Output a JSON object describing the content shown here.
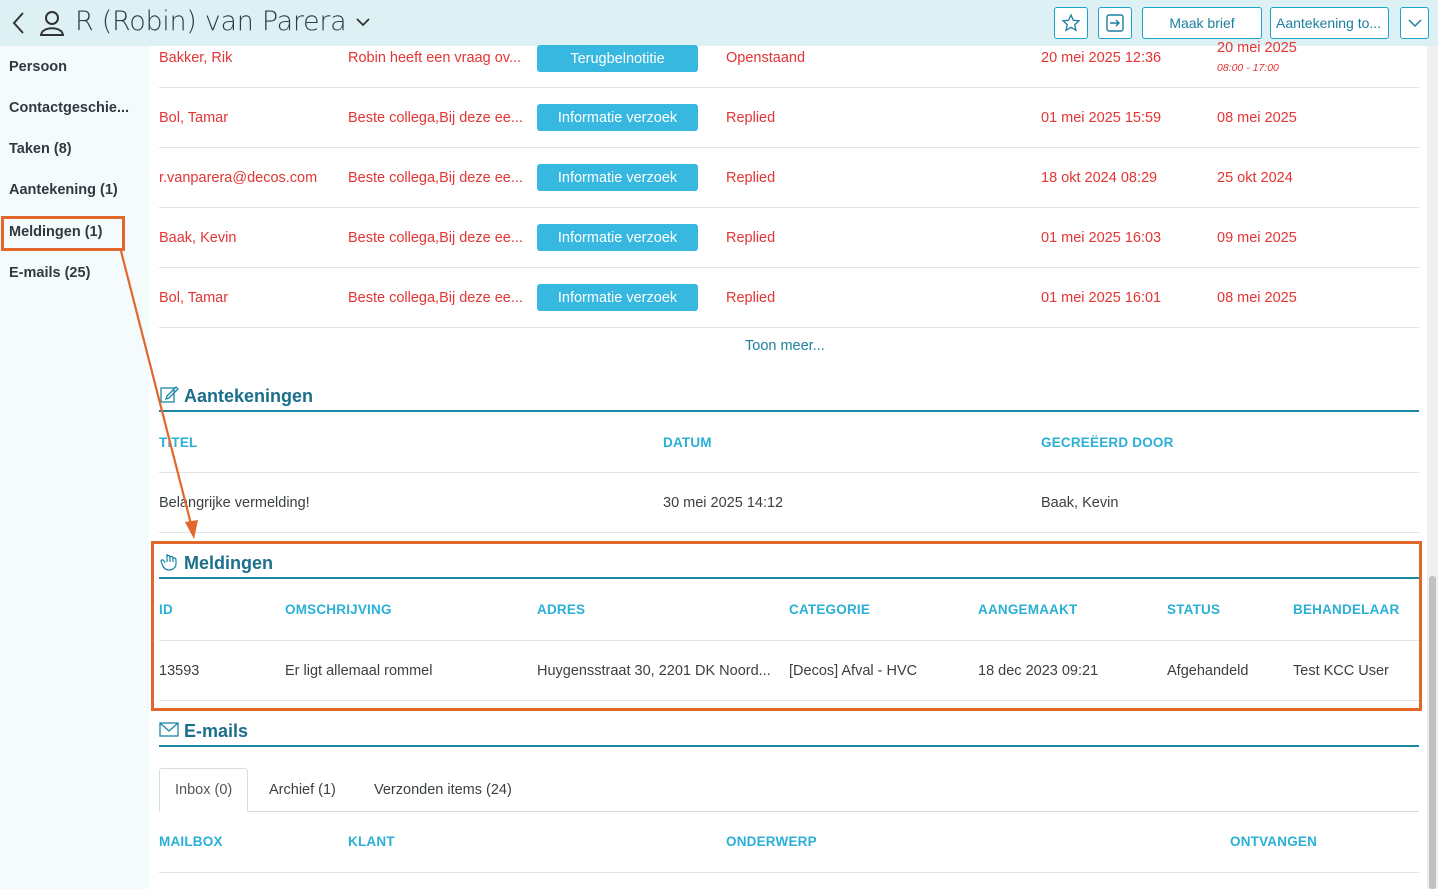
{
  "header": {
    "title": "R (Robin) van Parera",
    "buttons": {
      "maak_brief": "Maak brief",
      "aantekening": "Aantekening to..."
    }
  },
  "sidebar": {
    "items": [
      {
        "label": "Persoon"
      },
      {
        "label": "Contactgeschie..."
      },
      {
        "label": "Taken (8)"
      },
      {
        "label": "Aantekening (1)"
      },
      {
        "label": "Meldingen (1)"
      },
      {
        "label": "E-mails (25)"
      }
    ]
  },
  "tasks": {
    "rows": [
      {
        "name": "Bakker, Rik",
        "subject": "Robin heeft een vraag ov...",
        "type": "Terugbelnotitie",
        "status": "Openstaand",
        "created": "20 mei 2025 12:36",
        "due": "20 mei 2025",
        "due_sub": "08:00 - 17:00"
      },
      {
        "name": "Bol, Tamar",
        "subject": "Beste collega,Bij deze ee...",
        "type": "Informatie verzoek",
        "status": "Replied",
        "created": "01 mei 2025 15:59",
        "due": "08 mei 2025"
      },
      {
        "name": "r.vanparera@decos.com",
        "subject": "Beste collega,Bij deze ee...",
        "type": "Informatie verzoek",
        "status": "Replied",
        "created": "18 okt 2024 08:29",
        "due": "25 okt 2024"
      },
      {
        "name": "Baak, Kevin",
        "subject": "Beste collega,Bij deze ee...",
        "type": "Informatie verzoek",
        "status": "Replied",
        "created": "01 mei 2025 16:03",
        "due": "09 mei 2025"
      },
      {
        "name": "Bol, Tamar",
        "subject": "Beste collega,Bij deze ee...",
        "type": "Informatie verzoek",
        "status": "Replied",
        "created": "01 mei 2025 16:01",
        "due": "08 mei 2025"
      }
    ],
    "show_more": "Toon meer..."
  },
  "notes": {
    "title": "Aantekeningen",
    "headers": {
      "titel": "TITEL",
      "datum": "DATUM",
      "door": "GECREËERD DOOR"
    },
    "rows": [
      {
        "titel": "Belangrijke vermelding!",
        "datum": "30 mei 2025 14:12",
        "door": "Baak, Kevin"
      }
    ]
  },
  "meldingen": {
    "title": "Meldingen",
    "headers": {
      "id": "ID",
      "omschrijving": "OMSCHRIJVING",
      "adres": "ADRES",
      "categorie": "CATEGORIE",
      "aangemaakt": "AANGEMAAKT",
      "status": "STATUS",
      "behandelaar": "BEHANDELAAR"
    },
    "rows": [
      {
        "id": "13593",
        "omschrijving": "Er ligt allemaal rommel",
        "adres": "Huygensstraat 30, 2201 DK Noord...",
        "categorie": "[Decos] Afval - HVC",
        "aangemaakt": "18 dec 2023 09:21",
        "status": "Afgehandeld",
        "behandelaar": "Test KCC User"
      }
    ]
  },
  "emails": {
    "title": "E-mails",
    "tabs": [
      "Inbox (0)",
      "Archief (1)",
      "Verzonden items (24)"
    ],
    "headers": {
      "mailbox": "MAILBOX",
      "klant": "KLANT",
      "onderwerp": "ONDERWERP",
      "ontvangen": "ONTVANGEN"
    }
  },
  "colors": {
    "accent": "#36b8e0",
    "highlight": "#e2672a",
    "overdue": "#e43434",
    "heading": "#1b6f8c"
  }
}
